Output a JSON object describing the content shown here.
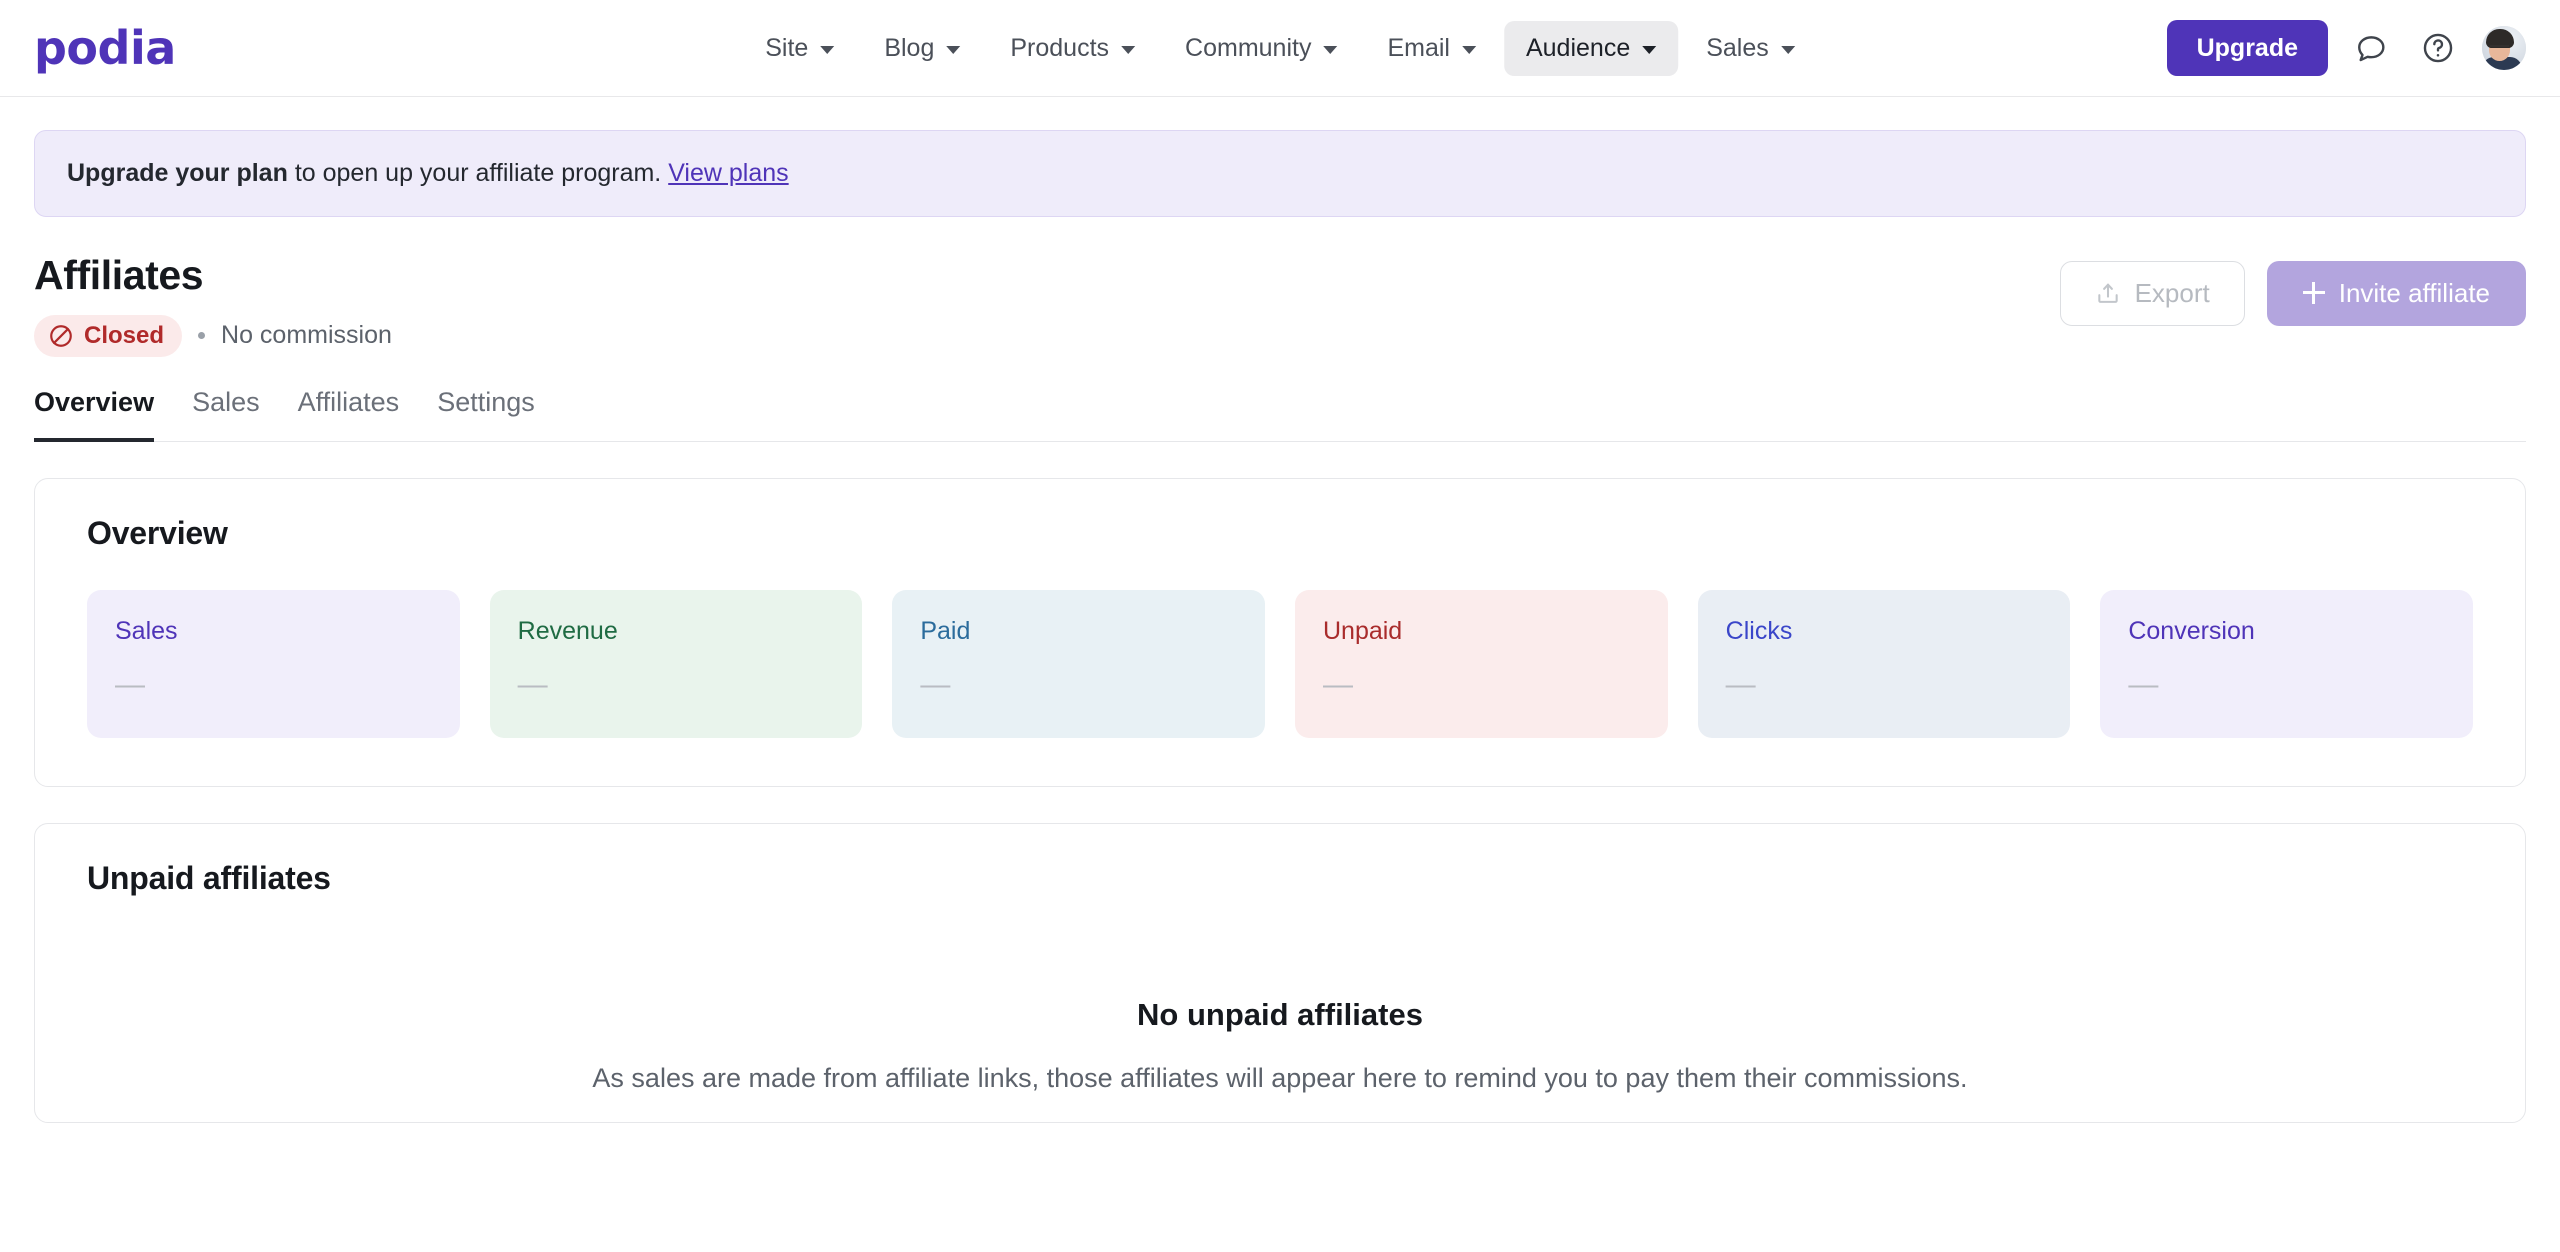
{
  "brand": {
    "logo_text": "podia",
    "accent_color": "#4f34b8"
  },
  "nav": {
    "items": [
      {
        "label": "Site",
        "active": false
      },
      {
        "label": "Blog",
        "active": false
      },
      {
        "label": "Products",
        "active": false
      },
      {
        "label": "Community",
        "active": false
      },
      {
        "label": "Email",
        "active": false
      },
      {
        "label": "Audience",
        "active": true
      },
      {
        "label": "Sales",
        "active": false
      }
    ],
    "upgrade_label": "Upgrade",
    "chat_icon": "chat-bubble-icon",
    "help_icon": "question-circle-icon",
    "avatar_icon": "user-avatar"
  },
  "banner": {
    "bold_text": "Upgrade your plan",
    "text": " to open up your affiliate program. ",
    "link_label": "View plans"
  },
  "header": {
    "title": "Affiliates",
    "status_badge": {
      "label": "Closed",
      "icon": "circle-slash-icon",
      "color": "#b02a2a",
      "background": "#fbeaea"
    },
    "separator": "•",
    "commission_text": "No commission",
    "export_label": "Export",
    "export_icon": "export-icon",
    "invite_label": "Invite affiliate",
    "invite_icon": "plus-icon"
  },
  "tabs": [
    {
      "label": "Overview",
      "active": true
    },
    {
      "label": "Sales",
      "active": false
    },
    {
      "label": "Affiliates",
      "active": false
    },
    {
      "label": "Settings",
      "active": false
    }
  ],
  "overview": {
    "title": "Overview",
    "stats": [
      {
        "label": "Sales",
        "value": "—",
        "text_color": "#4f34b8",
        "background": "#f1eefb"
      },
      {
        "label": "Revenue",
        "value": "—",
        "text_color": "#1f6b43",
        "background": "#e9f4ec"
      },
      {
        "label": "Paid",
        "value": "—",
        "text_color": "#2b6c9c",
        "background": "#e8f1f5"
      },
      {
        "label": "Unpaid",
        "value": "—",
        "text_color": "#a92c2c",
        "background": "#fbecec"
      },
      {
        "label": "Clicks",
        "value": "—",
        "text_color": "#3a46c9",
        "background": "#e9eef4"
      },
      {
        "label": "Conversion",
        "value": "—",
        "text_color": "#4f34b8",
        "background": "#f1eefb"
      }
    ]
  },
  "unpaid": {
    "title": "Unpaid affiliates",
    "empty_title": "No unpaid affiliates",
    "empty_text": "As sales are made from affiliate links, those affiliates will appear here to remind you to pay them their commissions."
  }
}
